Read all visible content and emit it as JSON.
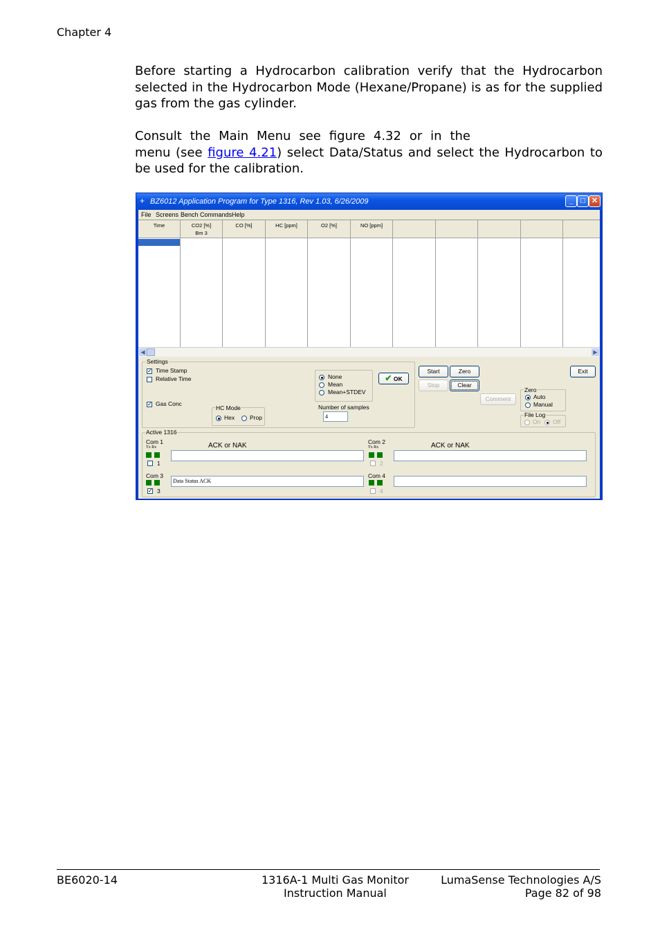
{
  "header": {
    "chapter": "Chapter 4"
  },
  "body": {
    "para1": "Before starting a Hydrocarbon calibration verify that the Hydrocarbon selected in the Hydrocarbon Mode (Hexane/Propane) is as for the supplied gas from the gas cylinder.",
    "para2_line1": "Consult the Main Menu see figure 4.32 or in the",
    "para2_pre": "menu (see ",
    "para2_link": "figure 4.21",
    "para2_post": ") select Data/Status and select the Hydrocarbon to be used for the calibration."
  },
  "window": {
    "title": "BZ6012 Application Program for Type 1316, Rev 1.03, 6/26/2009",
    "title_icon": "plus-icon",
    "menu": [
      "File",
      "Screens",
      "Bench Commands",
      "Help"
    ],
    "columns": [
      {
        "line1": "Time",
        "line2": ""
      },
      {
        "line1": "CO2 [%]",
        "line2": "Bm 3"
      },
      {
        "line1": "CO [%]",
        "line2": ""
      },
      {
        "line1": "HC [ppm]",
        "line2": ""
      },
      {
        "line1": "O2 [%]",
        "line2": ""
      },
      {
        "line1": "NO [ppm]",
        "line2": ""
      },
      {
        "line1": "",
        "line2": ""
      },
      {
        "line1": "",
        "line2": ""
      },
      {
        "line1": "",
        "line2": ""
      },
      {
        "line1": "",
        "line2": ""
      },
      {
        "line1": "",
        "line2": ""
      }
    ],
    "settings": {
      "title": "Settings",
      "time_stamp": "Time Stamp",
      "relative_time": "Relative Time",
      "gas_conc": "Gas Conc",
      "hc_mode_title": "HC Mode",
      "hex": "Hex",
      "prop": "Prop",
      "none": "None",
      "mean": "Mean",
      "mean_stdev": "Mean+STDEV",
      "ok": "OK",
      "num_samples_label": "Number of samples",
      "num_samples_value": "4"
    },
    "buttons": {
      "start": "Start",
      "zero": "Zero",
      "stop": "Stop",
      "clear": "Clear",
      "comment": "Comment",
      "exit": "Exit"
    },
    "zero_group": {
      "title": "Zero",
      "auto": "Auto",
      "manual": "Manual"
    },
    "file_log": {
      "title": "File Log",
      "on": "On",
      "off": "Off"
    },
    "active": {
      "title": "Active 1316",
      "txrx": "Tx Rx",
      "ack_nak": "ACK or  NAK",
      "com1": "Com 1",
      "com2": "Com 2",
      "com3": "Com 3",
      "com4": "Com 4",
      "n1": "1",
      "n2": "2",
      "n3": "3",
      "n4": "4",
      "com3_status": "Data Status  ACK"
    },
    "colors": {
      "titlebar": "#0b55e3",
      "led": "#007d00",
      "selection": "#316ac5"
    }
  },
  "footer": {
    "doc_id": "BE6020-14",
    "product": "1316A-1 Multi Gas Monitor",
    "manual": "Instruction Manual",
    "company": "LumaSense Technologies A/S",
    "page": "Page 82 of 98"
  }
}
